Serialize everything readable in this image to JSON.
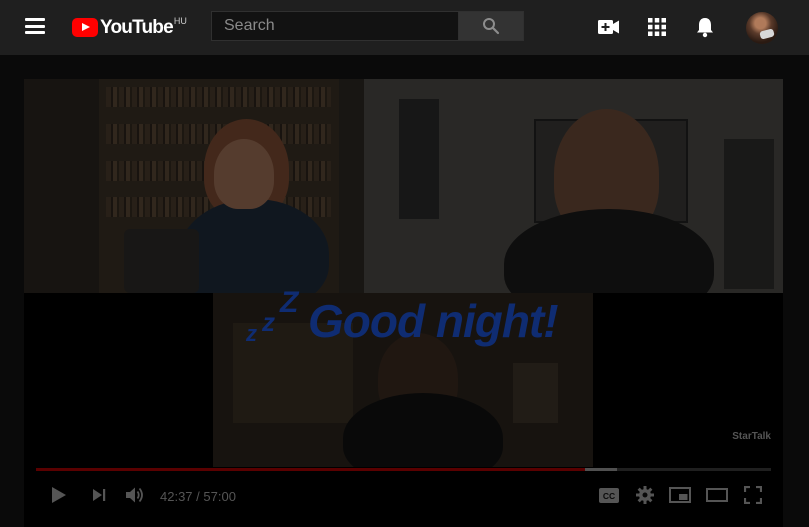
{
  "masthead": {
    "logo_text": "YouTube",
    "country_code": "HU",
    "search": {
      "placeholder": "Search"
    },
    "icons": [
      "menu-icon",
      "search-icon",
      "create-video-icon",
      "apps-icon",
      "notifications-icon"
    ]
  },
  "player": {
    "overlay_title": "Good night!",
    "zzz": [
      "z",
      "z",
      "Z"
    ],
    "watermark": "StarTalk",
    "time": {
      "current": "42:37",
      "separator": "/",
      "duration": "57:00"
    },
    "progress": {
      "played_fraction": 0.7474,
      "loaded_fraction": 0.79
    },
    "colors": {
      "overlay_text": "#0f2c72",
      "progress_played": "#5a0000",
      "logo_red": "#ff0000"
    }
  }
}
